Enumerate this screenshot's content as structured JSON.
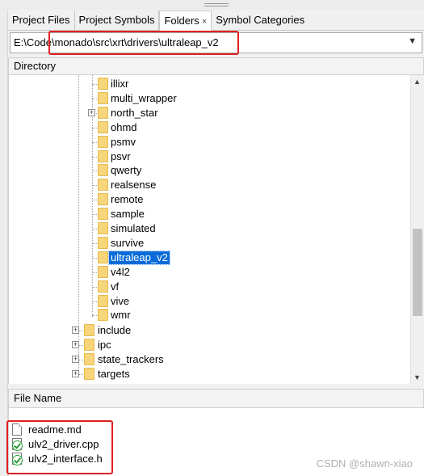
{
  "tabs": [
    {
      "label": "Project Files",
      "active": false
    },
    {
      "label": "Project Symbols",
      "active": false
    },
    {
      "label": "Folders",
      "active": true,
      "close": "×"
    },
    {
      "label": "Symbol Categories",
      "active": false
    }
  ],
  "path": {
    "value": "E:\\Code\\monado\\src\\xrt\\drivers\\ultraleap_v2"
  },
  "directory": {
    "header": "Directory",
    "driver_folders": [
      "illixr",
      "multi_wrapper",
      "north_star",
      "ohmd",
      "psmv",
      "psvr",
      "qwerty",
      "realsense",
      "remote",
      "sample",
      "simulated",
      "survive",
      "ultraleap_v2",
      "v4l2",
      "vf",
      "vive",
      "wmr"
    ],
    "selected": "ultraleap_v2",
    "expandable": [
      "north_star"
    ],
    "top_folders": [
      "include",
      "ipc",
      "state_trackers",
      "targets"
    ]
  },
  "files": {
    "header": "File Name",
    "items": [
      {
        "name": "readme.md",
        "icon": "document-icon"
      },
      {
        "name": "ulv2_driver.cpp",
        "icon": "source-file-icon"
      },
      {
        "name": "ulv2_interface.h",
        "icon": "source-file-icon"
      }
    ]
  },
  "watermark": "CSDN @shawn-xiao",
  "colors": {
    "selection": "#0a6bd8",
    "highlight_box": "#e02020",
    "folder": "#f7d57a"
  }
}
